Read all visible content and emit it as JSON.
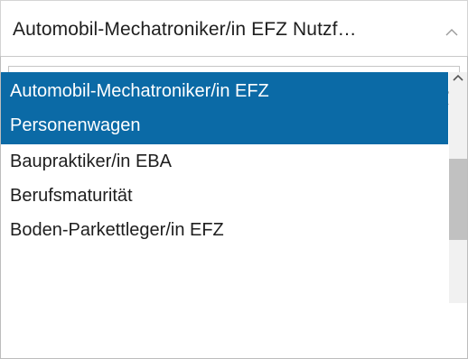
{
  "select": {
    "selected_value": "Automobil-Mechatroniker/in EFZ Nutzf…"
  },
  "search": {
    "value": "",
    "placeholder": ""
  },
  "options": [
    {
      "line1": "Automobil-Mechatroniker/in EFZ",
      "line2": "Personenwagen",
      "selected": true
    },
    {
      "line1": "Baupraktiker/in EBA",
      "selected": false
    },
    {
      "line1": "Berufsmaturität",
      "selected": false
    },
    {
      "line1": "Boden-Parkettleger/in EFZ",
      "selected": false
    }
  ],
  "colors": {
    "selected_bg": "#0b6aa6",
    "selected_text": "#ffffff",
    "scroll_thumb": "#c1c1c1"
  },
  "icons": {
    "toggle": "chevron-up-icon",
    "search": "search-icon",
    "scroll_up": "scroll-up-arrow-icon"
  }
}
